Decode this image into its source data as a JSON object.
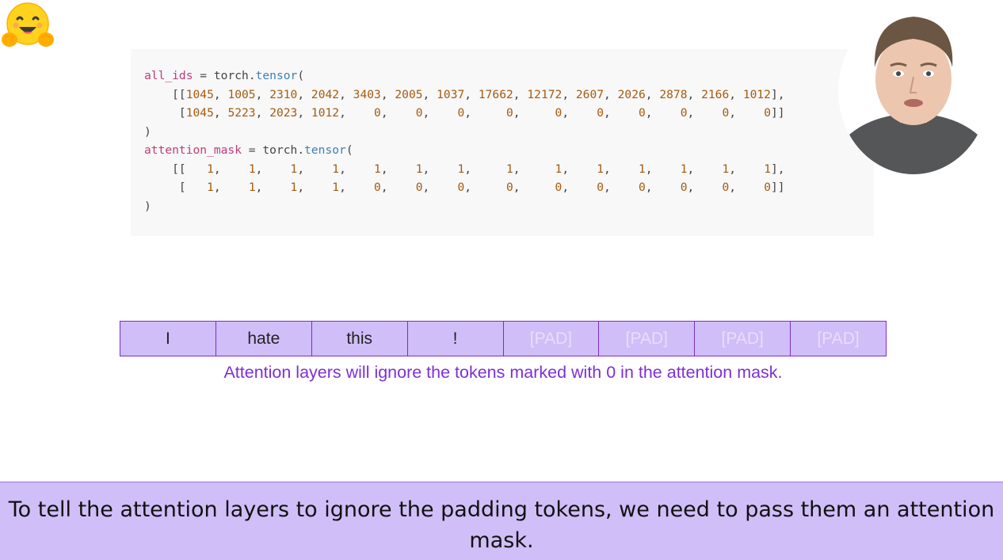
{
  "code": {
    "lines": [
      [
        {
          "t": "all_ids",
          "c": "n"
        },
        {
          "t": " = ",
          "c": "p"
        },
        {
          "t": "torch",
          "c": "p"
        },
        {
          "t": ".",
          "c": "p"
        },
        {
          "t": "tensor",
          "c": "m"
        },
        {
          "t": "(",
          "c": "p"
        }
      ],
      [
        {
          "t": "    [[",
          "c": "p"
        },
        {
          "t": "1045",
          "c": "v"
        },
        {
          "t": ", ",
          "c": "p"
        },
        {
          "t": "1005",
          "c": "v"
        },
        {
          "t": ", ",
          "c": "p"
        },
        {
          "t": "2310",
          "c": "v"
        },
        {
          "t": ", ",
          "c": "p"
        },
        {
          "t": "2042",
          "c": "v"
        },
        {
          "t": ", ",
          "c": "p"
        },
        {
          "t": "3403",
          "c": "v"
        },
        {
          "t": ", ",
          "c": "p"
        },
        {
          "t": "2005",
          "c": "v"
        },
        {
          "t": ", ",
          "c": "p"
        },
        {
          "t": "1037",
          "c": "v"
        },
        {
          "t": ", ",
          "c": "p"
        },
        {
          "t": "17662",
          "c": "v"
        },
        {
          "t": ", ",
          "c": "p"
        },
        {
          "t": "12172",
          "c": "v"
        },
        {
          "t": ", ",
          "c": "p"
        },
        {
          "t": "2607",
          "c": "v"
        },
        {
          "t": ", ",
          "c": "p"
        },
        {
          "t": "2026",
          "c": "v"
        },
        {
          "t": ", ",
          "c": "p"
        },
        {
          "t": "2878",
          "c": "v"
        },
        {
          "t": ", ",
          "c": "p"
        },
        {
          "t": "2166",
          "c": "v"
        },
        {
          "t": ", ",
          "c": "p"
        },
        {
          "t": "1012",
          "c": "v"
        },
        {
          "t": "],",
          "c": "p"
        }
      ],
      [
        {
          "t": "     [",
          "c": "p"
        },
        {
          "t": "1045",
          "c": "v"
        },
        {
          "t": ", ",
          "c": "p"
        },
        {
          "t": "5223",
          "c": "v"
        },
        {
          "t": ", ",
          "c": "p"
        },
        {
          "t": "2023",
          "c": "v"
        },
        {
          "t": ", ",
          "c": "p"
        },
        {
          "t": "1012",
          "c": "v"
        },
        {
          "t": ",    ",
          "c": "p"
        },
        {
          "t": "0",
          "c": "v"
        },
        {
          "t": ",    ",
          "c": "p"
        },
        {
          "t": "0",
          "c": "v"
        },
        {
          "t": ",    ",
          "c": "p"
        },
        {
          "t": "0",
          "c": "v"
        },
        {
          "t": ",     ",
          "c": "p"
        },
        {
          "t": "0",
          "c": "v"
        },
        {
          "t": ",     ",
          "c": "p"
        },
        {
          "t": "0",
          "c": "v"
        },
        {
          "t": ",    ",
          "c": "p"
        },
        {
          "t": "0",
          "c": "v"
        },
        {
          "t": ",    ",
          "c": "p"
        },
        {
          "t": "0",
          "c": "v"
        },
        {
          "t": ",    ",
          "c": "p"
        },
        {
          "t": "0",
          "c": "v"
        },
        {
          "t": ",    ",
          "c": "p"
        },
        {
          "t": "0",
          "c": "v"
        },
        {
          "t": ",    ",
          "c": "p"
        },
        {
          "t": "0",
          "c": "v"
        },
        {
          "t": "]]",
          "c": "p"
        }
      ],
      [
        {
          "t": ")",
          "c": "p"
        }
      ],
      [
        {
          "t": "attention_mask",
          "c": "n"
        },
        {
          "t": " = ",
          "c": "p"
        },
        {
          "t": "torch",
          "c": "p"
        },
        {
          "t": ".",
          "c": "p"
        },
        {
          "t": "tensor",
          "c": "m"
        },
        {
          "t": "(",
          "c": "p"
        }
      ],
      [
        {
          "t": "    [[   ",
          "c": "p"
        },
        {
          "t": "1",
          "c": "v"
        },
        {
          "t": ",    ",
          "c": "p"
        },
        {
          "t": "1",
          "c": "v"
        },
        {
          "t": ",    ",
          "c": "p"
        },
        {
          "t": "1",
          "c": "v"
        },
        {
          "t": ",    ",
          "c": "p"
        },
        {
          "t": "1",
          "c": "v"
        },
        {
          "t": ",    ",
          "c": "p"
        },
        {
          "t": "1",
          "c": "v"
        },
        {
          "t": ",    ",
          "c": "p"
        },
        {
          "t": "1",
          "c": "v"
        },
        {
          "t": ",    ",
          "c": "p"
        },
        {
          "t": "1",
          "c": "v"
        },
        {
          "t": ",     ",
          "c": "p"
        },
        {
          "t": "1",
          "c": "v"
        },
        {
          "t": ",     ",
          "c": "p"
        },
        {
          "t": "1",
          "c": "v"
        },
        {
          "t": ",    ",
          "c": "p"
        },
        {
          "t": "1",
          "c": "v"
        },
        {
          "t": ",    ",
          "c": "p"
        },
        {
          "t": "1",
          "c": "v"
        },
        {
          "t": ",    ",
          "c": "p"
        },
        {
          "t": "1",
          "c": "v"
        },
        {
          "t": ",    ",
          "c": "p"
        },
        {
          "t": "1",
          "c": "v"
        },
        {
          "t": ",    ",
          "c": "p"
        },
        {
          "t": "1",
          "c": "v"
        },
        {
          "t": "],",
          "c": "p"
        }
      ],
      [
        {
          "t": "     [   ",
          "c": "p"
        },
        {
          "t": "1",
          "c": "v"
        },
        {
          "t": ",    ",
          "c": "p"
        },
        {
          "t": "1",
          "c": "v"
        },
        {
          "t": ",    ",
          "c": "p"
        },
        {
          "t": "1",
          "c": "v"
        },
        {
          "t": ",    ",
          "c": "p"
        },
        {
          "t": "1",
          "c": "v"
        },
        {
          "t": ",    ",
          "c": "p"
        },
        {
          "t": "0",
          "c": "v"
        },
        {
          "t": ",    ",
          "c": "p"
        },
        {
          "t": "0",
          "c": "v"
        },
        {
          "t": ",    ",
          "c": "p"
        },
        {
          "t": "0",
          "c": "v"
        },
        {
          "t": ",     ",
          "c": "p"
        },
        {
          "t": "0",
          "c": "v"
        },
        {
          "t": ",     ",
          "c": "p"
        },
        {
          "t": "0",
          "c": "v"
        },
        {
          "t": ",    ",
          "c": "p"
        },
        {
          "t": "0",
          "c": "v"
        },
        {
          "t": ",    ",
          "c": "p"
        },
        {
          "t": "0",
          "c": "v"
        },
        {
          "t": ",    ",
          "c": "p"
        },
        {
          "t": "0",
          "c": "v"
        },
        {
          "t": ",    ",
          "c": "p"
        },
        {
          "t": "0",
          "c": "v"
        },
        {
          "t": ",    ",
          "c": "p"
        },
        {
          "t": "0",
          "c": "v"
        },
        {
          "t": "]]",
          "c": "p"
        }
      ],
      [
        {
          "t": ")",
          "c": "p"
        }
      ]
    ]
  },
  "tokens": [
    {
      "label": "I",
      "pad": false
    },
    {
      "label": "hate",
      "pad": false
    },
    {
      "label": "this",
      "pad": false
    },
    {
      "label": "!",
      "pad": false
    },
    {
      "label": "[PAD]",
      "pad": true
    },
    {
      "label": "[PAD]",
      "pad": true
    },
    {
      "label": "[PAD]",
      "pad": true
    },
    {
      "label": "[PAD]",
      "pad": true
    }
  ],
  "note": "Attention layers will ignore the tokens marked with 0 in the attention mask.",
  "caption": "To tell the attention layers to ignore the padding tokens, we need to pass them an attention mask.",
  "colors": {
    "accent": "#7d2bd1",
    "token_fill": "#d0bef8",
    "caption_bg": "#d0bef8",
    "note_text": "#7e2fd6",
    "code_value": "#a55a0e",
    "code_name": "#c23b7a",
    "code_method": "#3f7fb5"
  },
  "icons": {
    "logo": "hugging-face-emoji-icon",
    "presenter": "presenter-webcam"
  }
}
